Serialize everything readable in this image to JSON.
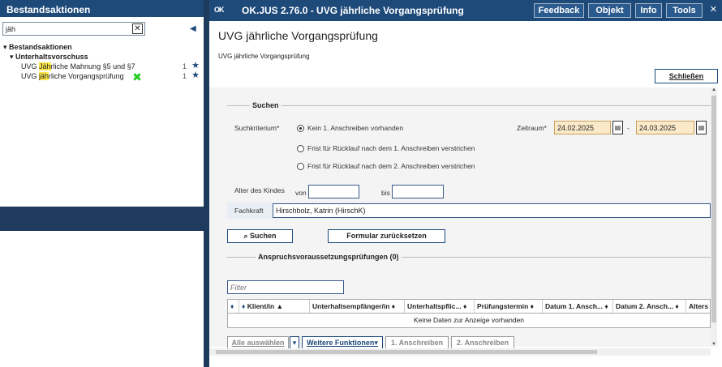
{
  "left": {
    "title": "Bestandsaktionen",
    "search_value": "jäh",
    "clear_label": "✕",
    "collapse_icon": "◀",
    "tree": [
      {
        "label": "Bestandsaktionen",
        "level": 0,
        "bold": true,
        "arrow": "▾"
      },
      {
        "label": "Unterhaltsvorschuss",
        "level": 1,
        "bold": true,
        "arrow": "▾"
      },
      {
        "pre": "UVG ",
        "hl": "Jäh",
        "post": "rliche Mahnung §5 und §7",
        "count": "1",
        "level": 2
      },
      {
        "pre": "UVG ",
        "hl": "jäh",
        "post": "rliche Vorgangsprüfung",
        "count": "1",
        "level": 2
      }
    ]
  },
  "topbar": {
    "logo": "OK",
    "title": "OK.JUS 2.76.0 - UVG jährliche Vorgangsprüfung",
    "buttons": [
      "Feedback",
      "Objekt",
      "Info",
      "Tools"
    ],
    "close": "✕"
  },
  "page": {
    "title": "UVG jährliche Vorgangsprüfung",
    "breadcrumb": "UVG jährliche Vorgangsprüfung",
    "close_button": "Schließen"
  },
  "search": {
    "legend": "Suchen",
    "criterion_label": "Suchkriterium*",
    "options": [
      {
        "label": "Kein 1. Anschreiben vorhanden",
        "selected": true
      },
      {
        "label": "Frist für Rücklauf nach dem 1. Anschreiben verstrichen",
        "selected": false
      },
      {
        "label": "Frist für Rücklauf nach dem 2. Anschreiben verstrichen",
        "selected": false
      }
    ],
    "zeitraum_label": "Zeitraum*",
    "date_from": "24.02.2025",
    "date_sep": "-",
    "date_to": "24.03.2025",
    "age_label": "Alter des Kindes",
    "age_from_label": "von",
    "age_to_label": "bis",
    "fachkraft_label": "Fachkraft",
    "fachkraft_value": "Hirschbolz, Katrin (HirschK)",
    "search_button": "Suchen",
    "reset_button": "Formular zurücksetzen"
  },
  "results": {
    "legend": "Anspruchsvoraussetzungsprüfungen (0)",
    "filter_placeholder": "Filter",
    "columns": [
      "Klient/in ▲",
      "Unterhaltsempfänger/in ♦",
      "Unterhaltspflic... ♦",
      "Prüfungstermin ♦",
      "Datum 1. Ansch... ♦",
      "Datum 2. Ansch... ♦",
      "Alters"
    ],
    "empty_text": "Keine Daten zur Anzeige vorhanden"
  },
  "bottom": {
    "select_all": "Alle auswählen",
    "more": "Weitere Funktionen▾",
    "first_letter": "1. Anschreiben",
    "second_letter": "2. Anschreiben"
  }
}
